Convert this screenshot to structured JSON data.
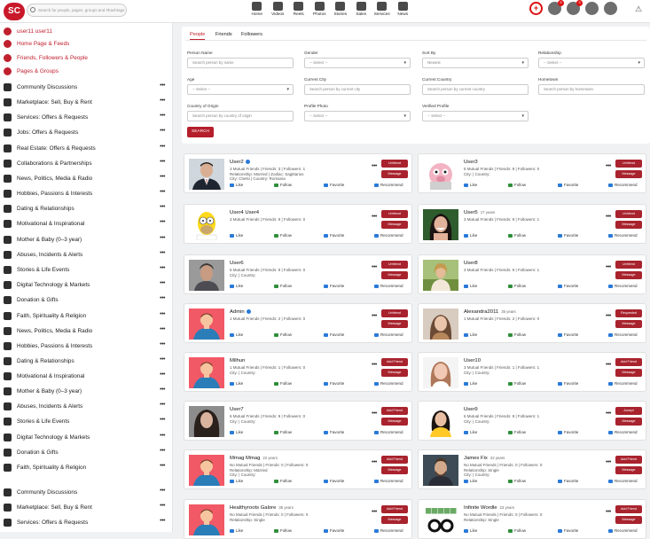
{
  "app": {
    "logo": "SC",
    "search_placeholder": "Search for people, pages, groups and #hashtags"
  },
  "topnav": [
    {
      "label": "Home"
    },
    {
      "label": "Videos"
    },
    {
      "label": "Reels"
    },
    {
      "label": "Photos"
    },
    {
      "label": "Stories"
    },
    {
      "label": "Sales"
    },
    {
      "label": "Services"
    },
    {
      "label": "News"
    }
  ],
  "header_icons": {
    "plus": "+",
    "notif_friends": "5",
    "notif_alerts": "3"
  },
  "sidebar": {
    "user": "user11 user11",
    "main": [
      "Home Page & Feeds",
      "Friends, Followers & People",
      "Pages & Groups"
    ],
    "items": [
      "Community Discussions",
      "Marketplace: Sell, Buy & Rent",
      "Services: Offers & Requests",
      "Jobs: Offers & Requests",
      "Real Estate: Offers & Requests",
      "Collaborations & Partnerships",
      "News, Politics, Media & Radio",
      "Hobbies, Passions & Interests",
      "Dating & Relationships",
      "Motivational & Inspirational",
      "Mother & Baby (0–3 year)",
      "Abuses, Incidents & Alerts",
      "Stories & Life Events",
      "Digital Technology & Markets",
      "Donation & Gifts",
      "Faith, Spirituality & Religion",
      "News, Politics, Media & Radio",
      "Hobbies, Passions & Interests",
      "Dating & Relationships",
      "Motivational & Inspirational",
      "Mother & Baby (0–3 year)",
      "Abuses, Incidents & Alerts",
      "Stories & Life Events",
      "Digital Technology & Markets",
      "Donation & Gifts",
      "Faith, Spirituality & Religion",
      "Community Discussions",
      "Marketplace: Sell, Buy & Rent",
      "Services: Offers & Requests"
    ]
  },
  "tabs": [
    "People",
    "Friends",
    "Followers"
  ],
  "filters": {
    "person_name": {
      "label": "Person Name",
      "placeholder": "Search person by name"
    },
    "gender": {
      "label": "Gender",
      "value": "-- Select --"
    },
    "sort_by": {
      "label": "Sort By",
      "value": "Newest"
    },
    "relationship": {
      "label": "Relationship",
      "value": "-- Select --"
    },
    "age": {
      "label": "Age",
      "value": "-- Select --"
    },
    "current_city": {
      "label": "Current City",
      "placeholder": "Search person by current city"
    },
    "current_country": {
      "label": "Current Country",
      "placeholder": "Search person by current country"
    },
    "hometown": {
      "label": "Hometown",
      "placeholder": "Search person by hometown"
    },
    "country_origin": {
      "label": "Country of Origin",
      "placeholder": "Search person by country of origin"
    },
    "profile_photo": {
      "label": "Profile Photo",
      "value": "-- Select --"
    },
    "verified_profile": {
      "label": "Verified Profile",
      "value": "-- Select --"
    },
    "search_button": "SEARCH"
  },
  "actions": {
    "like": "Like",
    "follow": "Follow",
    "favorite": "Favorite",
    "recommend": "Recommend"
  },
  "people": [
    {
      "name": "User2",
      "age": "",
      "verified": true,
      "l1": "3 Mutual Friends | Friends: 3 | Followers: 1",
      "l2": "Relationship: Married | Zodiac: Sagittarius",
      "l3": "City: Chelsi | Country: Romania",
      "b1": "Unfriend",
      "b2": "Message",
      "av": "suit"
    },
    {
      "name": "User3",
      "age": "",
      "verified": false,
      "l1": "5 Mutual Friends | Friends: 9 | Followers: 0",
      "l2": "City: | Country:",
      "l3": "",
      "b1": "Unfriend",
      "b2": "Message",
      "av": "pig"
    },
    {
      "name": "User4 User4",
      "age": "",
      "verified": false,
      "l1": "3 Mutual Friends | Friends: 9 | Followers: 0",
      "l2": "",
      "l3": "",
      "b1": "Unfriend",
      "b2": "Message",
      "av": "homer"
    },
    {
      "name": "User5",
      "age": "17 years",
      "verified": false,
      "l1": "3 Mutual Friends | Friends: 9 | Followers: 1",
      "l2": "",
      "l3": "",
      "b1": "Unfriend",
      "b2": "Message",
      "av": "woman"
    },
    {
      "name": "User6",
      "age": "",
      "verified": false,
      "l1": "5 Mutual Friends | Friends: 9 | Followers: 0",
      "l2": "City: | Country:",
      "l3": "",
      "b1": "Unfriend",
      "b2": "Message",
      "av": "man"
    },
    {
      "name": "User8",
      "age": "",
      "verified": false,
      "l1": "3 Mutual Friends | Friends: 9 | Followers: 1",
      "l2": "",
      "l3": "",
      "b1": "Unfriend",
      "b2": "Message",
      "av": "outdoor"
    },
    {
      "name": "Admin",
      "age": "",
      "verified": true,
      "l1": "1 Mutual Friends | Friends: 2 | Followers: 0",
      "l2": "",
      "l3": "",
      "b1": "Unfriend",
      "b2": "Message",
      "av": "default"
    },
    {
      "name": "Alexandra2011",
      "age": "35 years",
      "verified": false,
      "l1": "1 Mutual Friends | Friends: 2 | Followers: 0",
      "l2": "",
      "l3": "",
      "b1": "Requested",
      "b2": "Message",
      "av": "lady"
    },
    {
      "name": "Milhun",
      "age": "",
      "verified": false,
      "l1": "1 Mutual Friends | Friends: 1 | Followers: 0",
      "l2": "City: | Country:",
      "l3": "",
      "b1": "Add Friend",
      "b2": "Message",
      "av": "default"
    },
    {
      "name": "User10",
      "age": "",
      "verified": false,
      "l1": "3 Mutual Friends | Friends: 1 | Followers: 1",
      "l2": "City: | Country:",
      "l3": "",
      "b1": "Add Friend",
      "b2": "Message",
      "av": "blonde"
    },
    {
      "name": "User7",
      "age": "",
      "verified": false,
      "l1": "6 Mutual Friends | Friends: 9 | Followers: 0",
      "l2": "City: | Country:",
      "l3": "",
      "b1": "Add Friend",
      "b2": "Message",
      "av": "hair"
    },
    {
      "name": "User9",
      "age": "",
      "verified": false,
      "l1": "6 Mutual Friends | Friends: 9 | Followers: 1",
      "l2": "City: | Country:",
      "l3": "",
      "b1": "Accept",
      "b2": "Message",
      "av": "yellow"
    },
    {
      "name": "Mmag Mmag",
      "age": "22 years",
      "verified": false,
      "l1": "No Mutual Friends | Friends: 0 | Followers: 0",
      "l2": "Relationship: Married",
      "l3": "City: | Country:",
      "b1": "Add Friend",
      "b2": "Message",
      "av": "default"
    },
    {
      "name": "James Fix",
      "age": "22 years",
      "verified": false,
      "l1": "No Mutual Friends | Friends: 0 | Followers: 0",
      "l2": "Relationship: Single",
      "l3": "City: | Country:",
      "b1": "Add Friend",
      "b2": "Message",
      "av": "james"
    },
    {
      "name": "Healthyroots Galore",
      "age": "35 years",
      "verified": false,
      "l1": "No Mutual Friends | Friends: 0 | Followers: 0",
      "l2": "Relationship: Single",
      "l3": "",
      "b1": "Add Friend",
      "b2": "Message",
      "av": "default"
    },
    {
      "name": "Infinite Wordle",
      "age": "23 years",
      "verified": false,
      "l1": "No Mutual Friends | Friends: 0 | Followers: 0",
      "l2": "Relationship: Single",
      "l3": "",
      "b1": "Add Friend",
      "b2": "Message",
      "av": "wordle"
    }
  ]
}
